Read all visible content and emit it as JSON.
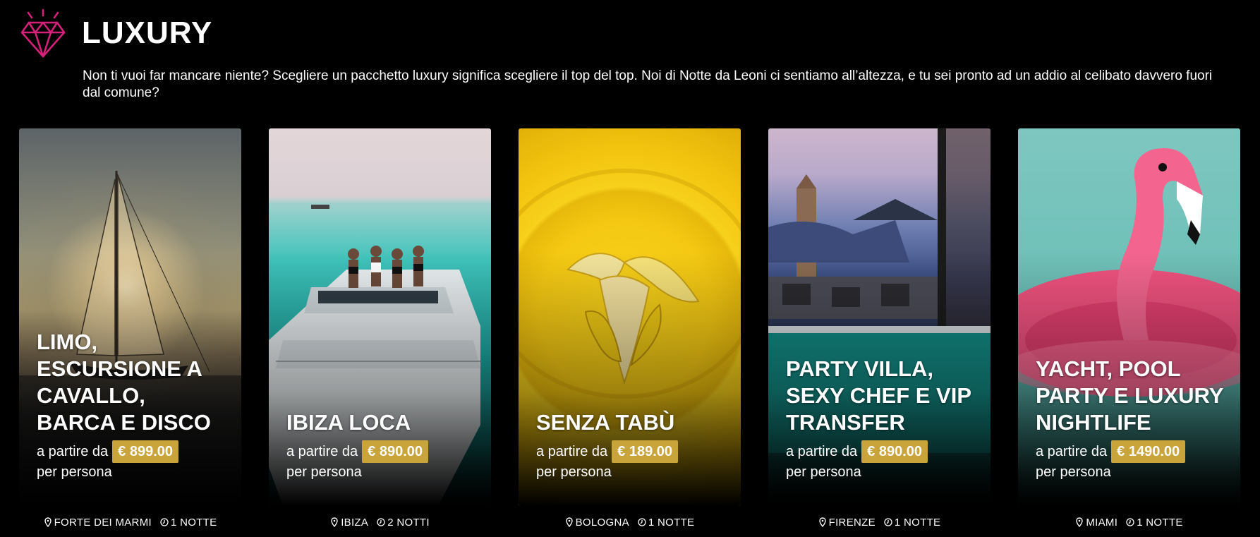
{
  "section": {
    "title": "LUXURY",
    "icon": "diamond-icon",
    "accent_color": "#d6217a",
    "intro": "Non ti vuoi far mancare niente? Scegliere un pacchetto luxury significa scegliere il top del top. Noi di Notte da Leoni ci sentiamo all’altezza, e tu sei pronto ad un addio al celibato davvero fuori dal comune?"
  },
  "price_badge_color": "#c9a43a",
  "cards": [
    {
      "title": "LIMO, ESCURSIONE A CAVALLO, BARCA E DISCO",
      "price_prefix": "a partire da",
      "price": "€ 899.00",
      "price_suffix": "per persona",
      "location": "FORTE DEI MARMI",
      "duration": "1 NOTTE",
      "image_desc": "sailboat-sunset"
    },
    {
      "title": "IBIZA LOCA",
      "price_prefix": "a partire da",
      "price": "€ 890.00",
      "price_suffix": "per persona",
      "location": "IBIZA",
      "duration": "2 NOTTI",
      "image_desc": "boat-turquoise-sea"
    },
    {
      "title": "SENZA TABÙ",
      "price_prefix": "a partire da",
      "price": "€ 189.00",
      "price_suffix": "per persona",
      "location": "BOLOGNA",
      "duration": "1 NOTTE",
      "image_desc": "banana-yellow-plate"
    },
    {
      "title": "PARTY VILLA, SEXY CHEF E VIP TRANSFER",
      "price_prefix": "a partire da",
      "price": "€ 890.00",
      "price_suffix": "per persona",
      "location": "FIRENZE",
      "duration": "1 NOTTE",
      "image_desc": "rooftop-pool-florence"
    },
    {
      "title": "YACHT, POOL PARTY E LUXURY NIGHTLIFE",
      "price_prefix": "a partire da",
      "price": "€ 1490.00",
      "price_suffix": "per persona",
      "location": "MIAMI",
      "duration": "1 NOTTE",
      "image_desc": "pink-flamingo-float"
    }
  ]
}
